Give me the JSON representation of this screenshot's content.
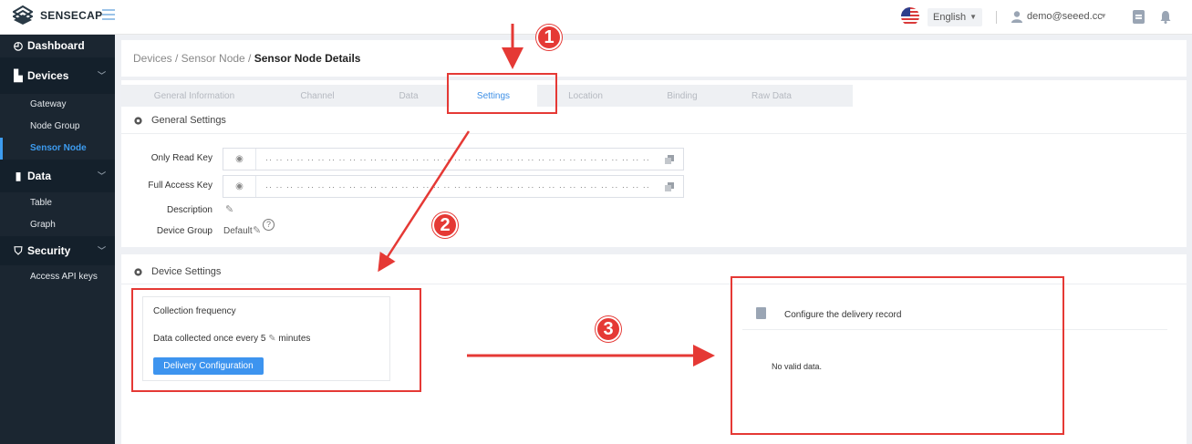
{
  "header": {
    "logo_text": "SENSECAP",
    "language": "English",
    "user_email": "demo@seeed.cc"
  },
  "sidebar": {
    "dashboard": "Dashboard",
    "devices": "Devices",
    "devices_items": [
      "Gateway",
      "Node Group",
      "Sensor Node"
    ],
    "data": "Data",
    "data_items": [
      "Table",
      "Graph"
    ],
    "security": "Security",
    "security_items": [
      "Access API keys"
    ]
  },
  "breadcrumb": {
    "part1": "Devices / Sensor Node /",
    "current": "Sensor Node Details"
  },
  "tabs": [
    "General Information",
    "Channel",
    "Data",
    "Settings",
    "Location",
    "Binding",
    "Raw Data"
  ],
  "active_tab": "Settings",
  "general_settings": {
    "title": "General Settings",
    "only_read_key_label": "Only Read Key",
    "full_access_key_label": "Full Access Key",
    "masked_key": "·· ·· ·· ·· ·· ·· ·· ·· ·· ·· ·· ·· ·· ·· ·· ·· ·· ·· ·· ·· ·· ·· ·· ·· ·· ·· ·· ·· ·· ·· ·· ·· ·· ·· ·· ·· ··",
    "description_label": "Description",
    "device_group_label": "Device Group",
    "device_group_value": "Default"
  },
  "device_settings": {
    "title": "Device Settings",
    "collection_frequency": "Collection frequency",
    "interval_prefix": "Data collected once every",
    "interval_value": "5",
    "interval_unit": "minutes",
    "delivery_button": "Delivery Configuration"
  },
  "delivery_record": {
    "title": "Configure the delivery record",
    "empty_text": "No valid data."
  },
  "annotations": {
    "step1": "1",
    "step2": "2",
    "step3": "3",
    "color": "#e53935"
  },
  "colors": {
    "accent": "#3d94ef",
    "sidebar_bg": "#1b2631"
  }
}
